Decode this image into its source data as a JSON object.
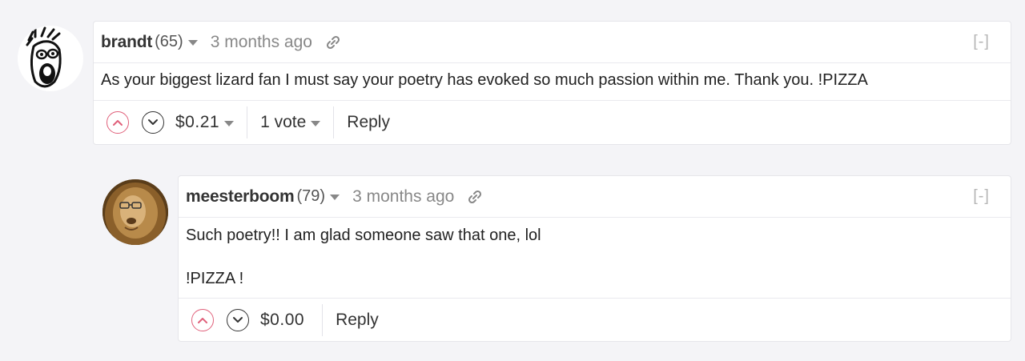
{
  "comments": [
    {
      "author": "brandt",
      "reputation": "(65)",
      "time": "3 months ago",
      "collapse": "[-]",
      "body": [
        "As your biggest lizard fan I must say your poetry has evoked so much passion within me. Thank you. !PIZZA"
      ],
      "payout": "$0.21",
      "votes": "1 vote",
      "reply": "Reply"
    },
    {
      "author": "meesterboom",
      "reputation": "(79)",
      "time": "3 months ago",
      "collapse": "[-]",
      "body": [
        "Such poetry!! I am glad someone saw that one, lol",
        "!PIZZA !"
      ],
      "payout": "$0.00",
      "reply": "Reply"
    }
  ],
  "icons": {
    "upvote": "chevron-up-circle-icon",
    "downvote": "chevron-down-circle-icon",
    "permalink": "link-icon",
    "dropdown": "caret-down-icon"
  },
  "colors": {
    "upvote": "#e0607a",
    "background": "#f4f4f7"
  }
}
